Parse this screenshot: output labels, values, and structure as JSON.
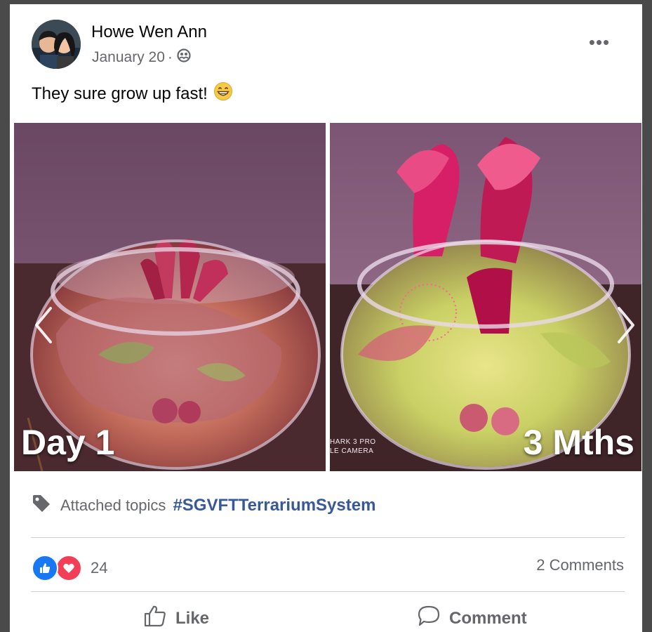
{
  "post": {
    "author": "Howe Wen Ann",
    "date": "January 20",
    "separator": "·",
    "privacy_icon": "friends-icon",
    "text": "They sure grow up fast!",
    "emoji": "😁",
    "more_icon": "more-options-icon",
    "more_label": "•••"
  },
  "photos": [
    {
      "caption": "Day 1"
    },
    {
      "caption": "3 Mths",
      "watermark_line1": "HARK 3 PRO",
      "watermark_line2": "LE CAMERA"
    }
  ],
  "topics": {
    "label": "Attached topics",
    "hashtag": "#SGVFTTerrariumSystem"
  },
  "reactions": {
    "count": "24",
    "types": [
      "like",
      "love"
    ],
    "comments": "2 Comments"
  },
  "actions": {
    "like": "Like",
    "comment": "Comment"
  },
  "colors": {
    "accent": "#385898",
    "like_blue": "#1877f2",
    "love_red": "#f33e58",
    "secondary_text": "#65676b"
  }
}
